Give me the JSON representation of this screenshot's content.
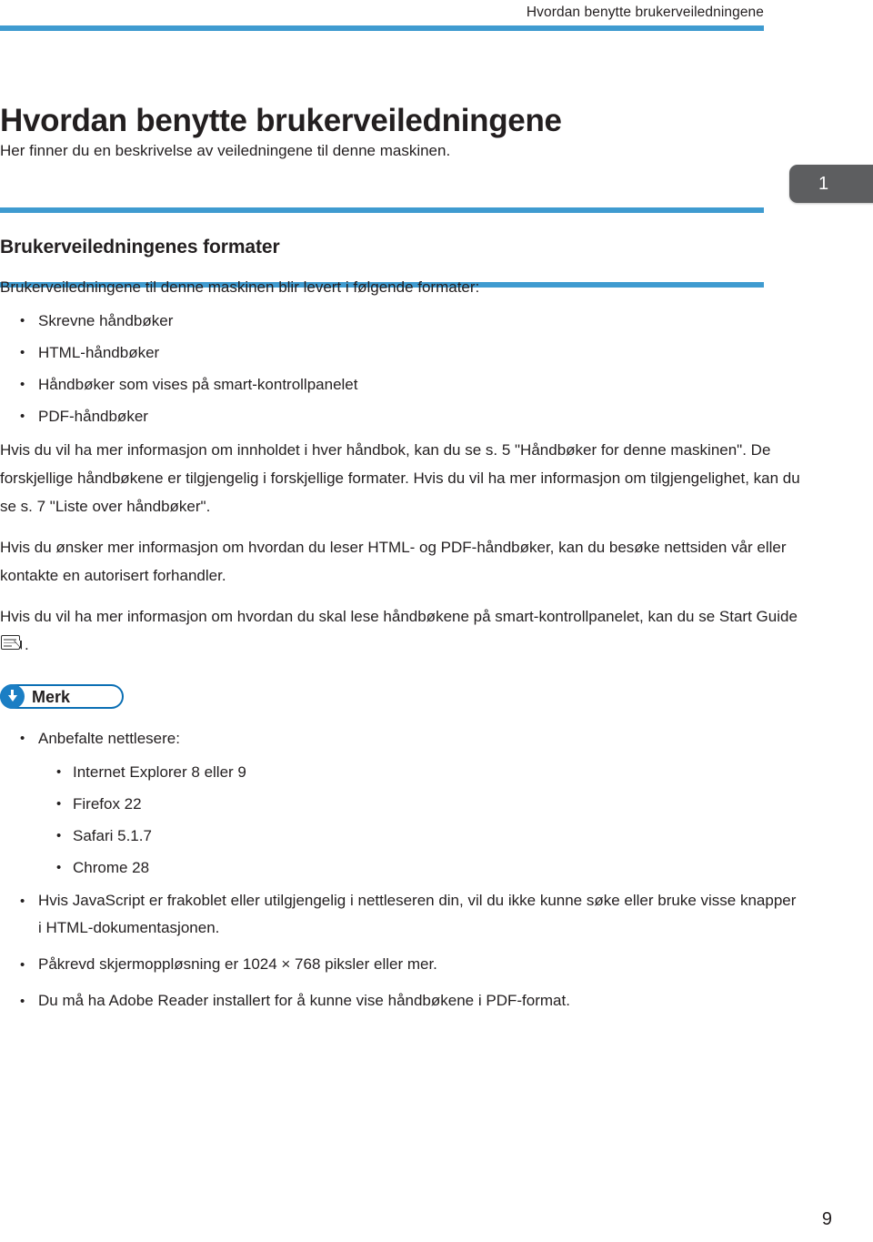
{
  "header": {
    "running_title": "Hvordan benytte brukerveiledningene"
  },
  "chapter_tab": {
    "number": "1"
  },
  "page": {
    "title": "Hvordan benytte brukerveiledningene",
    "subtitle": "Her finner du en beskrivelse av veiledningene til denne maskinen.",
    "footer_page_number": "9"
  },
  "section": {
    "heading": "Brukerveiledningenes formater",
    "intro": "Brukerveiledningene til denne maskinen blir levert i følgende formater:",
    "format_items": [
      "Skrevne håndbøker",
      "HTML-håndbøker",
      "Håndbøker som vises på smart-kontrollpanelet",
      "PDF-håndbøker"
    ],
    "paragraph_1": "Hvis du vil ha mer informasjon om innholdet i hver håndbok, kan du se s. 5 \"Håndbøker for denne maskinen\". De forskjellige håndbøkene er tilgjengelig i forskjellige formater. Hvis du vil ha mer informasjon om tilgjengelighet, kan du se s. 7 \"Liste over håndbøker\".",
    "paragraph_2": "Hvis du ønsker mer informasjon om hvordan du leser HTML- og PDF-håndbøker, kan du besøke nettsiden vår eller kontakte en autorisert forhandler.",
    "paragraph_3_before_icon": "Hvis du vil ha mer informasjon om hvordan du skal lese håndbøkene på smart-kontrollpanelet, kan du se Start Guide",
    "paragraph_3_after_icon": "."
  },
  "note": {
    "label": "Merk",
    "icon": "down-arrow-circle-icon",
    "browsers_heading": "Anbefalte nettlesere:",
    "browsers": [
      "Internet Explorer 8 eller 9",
      "Firefox 22",
      "Safari 5.1.7",
      "Chrome 28"
    ],
    "requirements": [
      "Hvis JavaScript er frakoblet eller utilgjengelig i nettleseren din, vil du ikke kunne søke eller bruke visse knapper i HTML-dokumentasjonen.",
      "Påkrevd skjermoppløsning er 1024 × 768 piksler eller mer.",
      "Du må ha Adobe Reader installert for å kunne vise håndbøkene i PDF-format."
    ]
  },
  "colors": {
    "rule_blue": "#3f9bd0",
    "note_outline_blue": "#0b6fb4",
    "note_circle_blue": "#1b7ec4",
    "tab_gray": "#5d5e60",
    "text": "#231f20"
  }
}
